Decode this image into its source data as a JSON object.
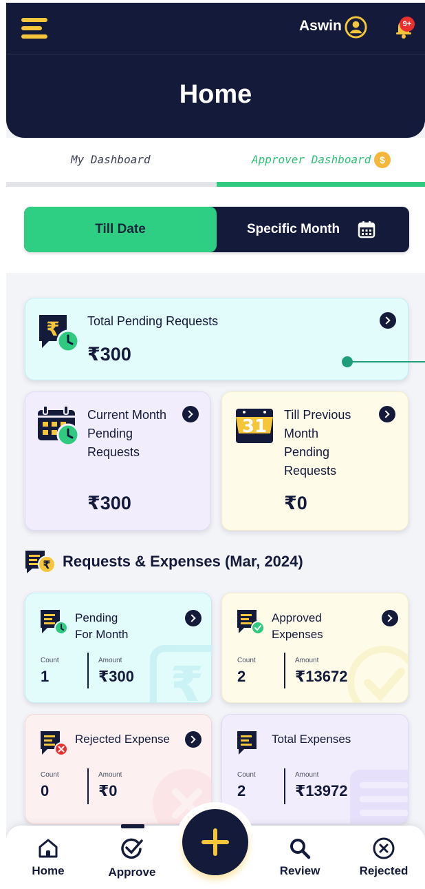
{
  "header": {
    "user_name": "Aswin",
    "notification_badge": "9+",
    "title": "Home"
  },
  "dashboard_tabs": [
    {
      "label": "My Dashboard",
      "active": false
    },
    {
      "label": "Approver Dashboard",
      "active": true
    }
  ],
  "coin_symbol": "$",
  "toggle": {
    "options": [
      "Till Date",
      "Specific Month"
    ],
    "selected": "Till Date"
  },
  "summary_cards": {
    "total_pending": {
      "title": "Total Pending Requests",
      "amount": "₹300"
    },
    "current_month": {
      "title_lines": [
        "Current Month",
        "Pending",
        "Requests"
      ],
      "amount": "₹300",
      "calendar_day": ""
    },
    "till_previous": {
      "title_lines": [
        "Till Previous",
        "Month",
        "Pending",
        "Requests"
      ],
      "amount": "₹0",
      "calendar_day": "31"
    }
  },
  "section": {
    "title": "Requests & Expenses (Mar, 2024)"
  },
  "labels": {
    "count": "Count",
    "amount": "Amount"
  },
  "expense_cards": [
    {
      "title_lines": [
        "Pending",
        "For Month"
      ],
      "count": "1",
      "amount": "₹300"
    },
    {
      "title_lines": [
        "Approved",
        "Expenses"
      ],
      "count": "2",
      "amount": "₹13672"
    },
    {
      "title_lines": [
        "Rejected Expense"
      ],
      "count": "0",
      "amount": "₹0"
    },
    {
      "title_lines": [
        "Total Expenses"
      ],
      "count": "2",
      "amount": "₹13972"
    }
  ],
  "bottom_nav": [
    {
      "label": "Home",
      "icon": "home-icon"
    },
    {
      "label": "Approve",
      "icon": "approve-check-icon"
    },
    {
      "label": "Review",
      "icon": "search-icon"
    },
    {
      "label": "Rejected",
      "icon": "x-circle-icon"
    }
  ],
  "colors": {
    "navy": "#141a3a",
    "accent_green": "#2fcf83",
    "accent_yellow": "#f6c63a",
    "badge_red": "#e8312f"
  }
}
